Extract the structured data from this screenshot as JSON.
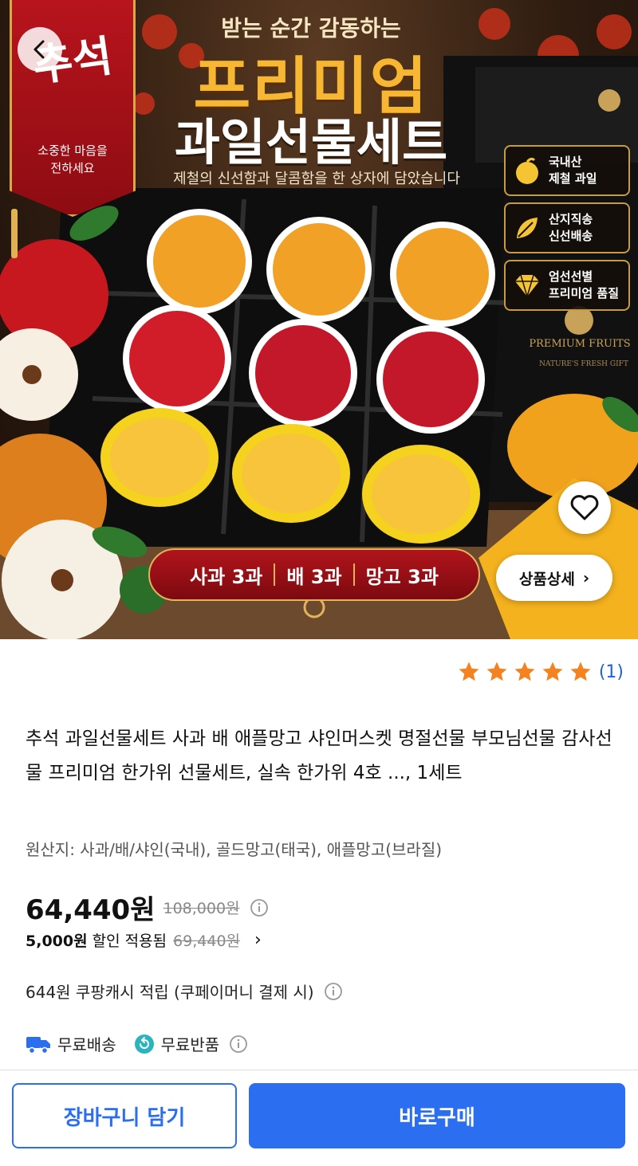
{
  "hero": {
    "banner_title": "추석",
    "banner_sub": "소중한 마음을\n전하세요",
    "eyebrow": "받는 순간 감동하는",
    "title_line1": "프리미엄",
    "title_line2": "과일선물세트",
    "tagline": "제철의 신선함과 달콤함을 한 상자에 담았습니다",
    "badges": [
      {
        "icon": "apple-icon",
        "text": "국내산\n제철 과일"
      },
      {
        "icon": "leaf-icon",
        "text": "산지직송\n신선배송"
      },
      {
        "icon": "diamond-icon",
        "text": "엄선선별\n프리미엄 품질"
      }
    ],
    "giftbox_label": "PREMIUM FRUITS",
    "giftbox_sub": "NATURE'S FRESH GIFT",
    "contents": [
      "사과 3과",
      "배 3과",
      "망고 3과"
    ],
    "detail_button": "상품상세"
  },
  "rating": {
    "stars": 5,
    "count": "(1)"
  },
  "product": {
    "title": "추석 과일선물세트 사과 배 애플망고 샤인머스켓 명절선물 부모님선물 감사선물 프리미엄 한가위 선물세트, 실속 한가위 4호 ..., 1세트",
    "origin": "원산지: 사과/배/샤인(국내), 골드망고(태국), 애플망고(브라질)"
  },
  "price": {
    "current": "64,440원",
    "original": "108,000원",
    "discount_amount": "5,000원",
    "discount_text": "할인 적용됨",
    "discount_original": "69,440원"
  },
  "cashback": "644원 쿠팡캐시 적립 (쿠페이머니 결제 시)",
  "shipping": {
    "free_delivery": "무료배송",
    "free_return": "무료반품"
  },
  "actions": {
    "cart": "장바구니 담기",
    "buy": "바로구매"
  },
  "colors": {
    "accent": "#2b6ef0",
    "star": "#f58220",
    "banner_red": "#b8141d",
    "gold": "#f7b733"
  }
}
